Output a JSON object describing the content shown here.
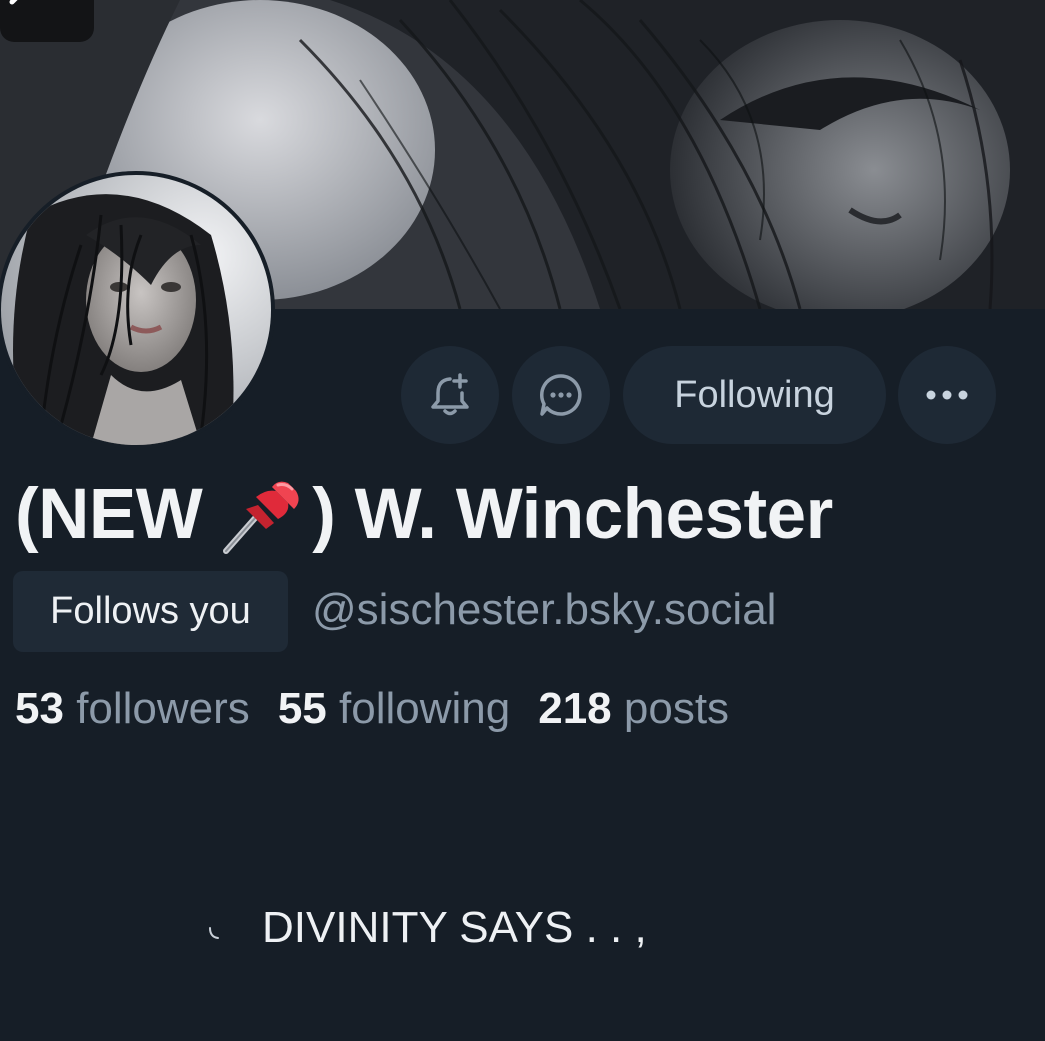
{
  "profile": {
    "display_name_prefix": "(NEW",
    "pin_emoji": "pushpin-icon",
    "display_name_suffix": ") W. Winchester",
    "follows_you": "Follows you",
    "handle": "@sischester.bsky.social",
    "bio": "DIVINITY SAYS  . . ,"
  },
  "actions": {
    "subscribe_icon": "bell-plus-icon",
    "message_icon": "chat-bubble-icon",
    "following_label": "Following",
    "more_icon": "ellipsis-icon"
  },
  "stats": {
    "followers_count": "53",
    "followers_label": "followers",
    "following_count": "55",
    "following_label": "following",
    "posts_count": "218",
    "posts_label": "posts"
  },
  "colors": {
    "background": "#161e27",
    "button_bg": "#1e2935",
    "text_primary": "#f1f3f5",
    "text_secondary": "#8c9aa9"
  }
}
